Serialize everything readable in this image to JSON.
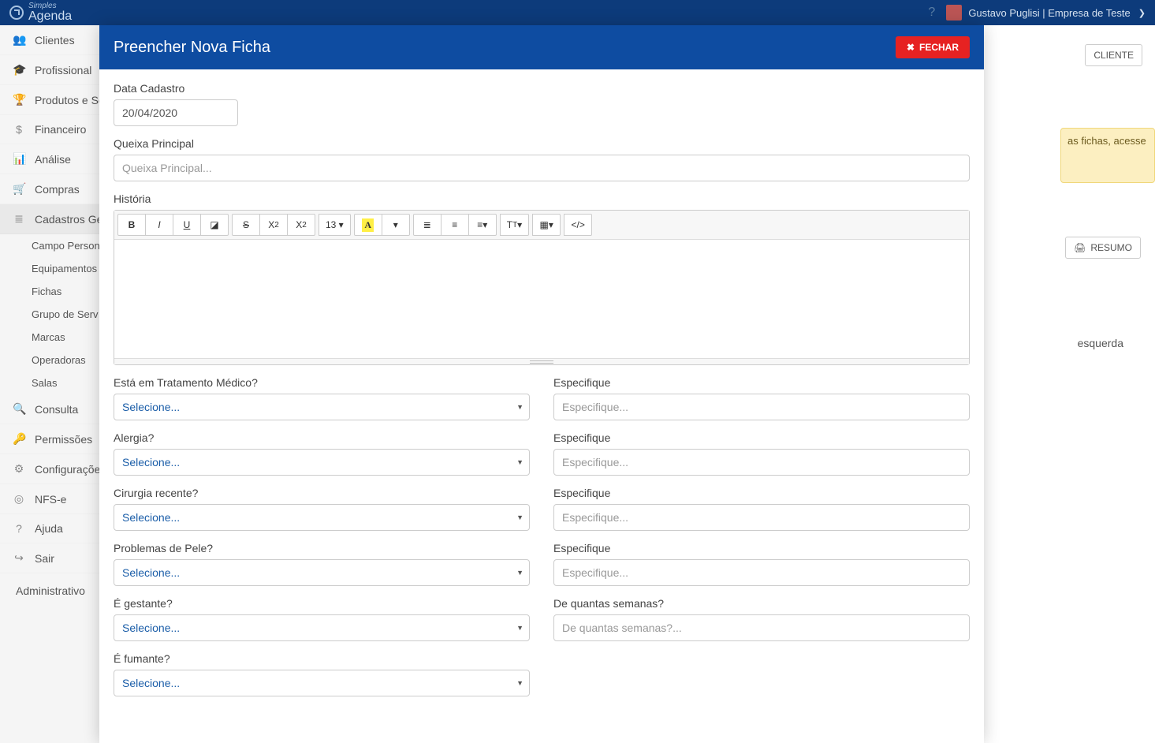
{
  "brand": {
    "line1": "Simples",
    "line2": "Agenda"
  },
  "topbar": {
    "user": "Gustavo Puglisi | Empresa de Teste"
  },
  "sidebar": {
    "items": [
      {
        "icon": "👥",
        "label": "Clientes"
      },
      {
        "icon": "🎓",
        "label": "Profissional"
      },
      {
        "icon": "🏆",
        "label": "Produtos e Se"
      },
      {
        "icon": "$",
        "label": "Financeiro"
      },
      {
        "icon": "📊",
        "label": "Análise"
      },
      {
        "icon": "🛒",
        "label": "Compras"
      },
      {
        "icon": "≣",
        "label": "Cadastros Ger"
      }
    ],
    "sub": [
      "Campo Person",
      "Equipamentos",
      "Fichas",
      "Grupo de Serv",
      "Marcas",
      "Operadoras",
      "Salas"
    ],
    "items2": [
      {
        "icon": "🔍",
        "label": "Consulta"
      },
      {
        "icon": "🔑",
        "label": "Permissões"
      },
      {
        "icon": "⚙",
        "label": "Configurações"
      },
      {
        "icon": "◎",
        "label": "NFS-e"
      },
      {
        "icon": "?",
        "label": "Ajuda"
      },
      {
        "icon": "↪",
        "label": "Sair"
      }
    ],
    "admin": "Administrativo"
  },
  "bg": {
    "cliente": "CLIENTE",
    "banner": "as fichas, acesse",
    "resumo": "RESUMO",
    "text": "esquerda"
  },
  "modal": {
    "title": "Preencher Nova Ficha",
    "close": "FECHAR",
    "data_cadastro_label": "Data Cadastro",
    "data_cadastro_value": "20/04/2020",
    "queixa_label": "Queixa Principal",
    "queixa_placeholder": "Queixa Principal...",
    "historia_label": "História",
    "font_size": "13 ▾",
    "selecione": "Selecione...",
    "q1": {
      "label": "Está em Tratamento Médico?",
      "spec": "Especifique",
      "spec_ph": "Especifique..."
    },
    "q2": {
      "label": "Alergia?",
      "spec": "Especifique",
      "spec_ph": "Especifique..."
    },
    "q3": {
      "label": "Cirurgia recente?",
      "spec": "Especifique",
      "spec_ph": "Especifique..."
    },
    "q4": {
      "label": "Problemas de Pele?",
      "spec": "Especifique",
      "spec_ph": "Especifique..."
    },
    "q5": {
      "label": "É gestante?",
      "spec": "De quantas semanas?",
      "spec_ph": "De quantas semanas?..."
    },
    "q6": {
      "label": "É fumante?"
    }
  }
}
